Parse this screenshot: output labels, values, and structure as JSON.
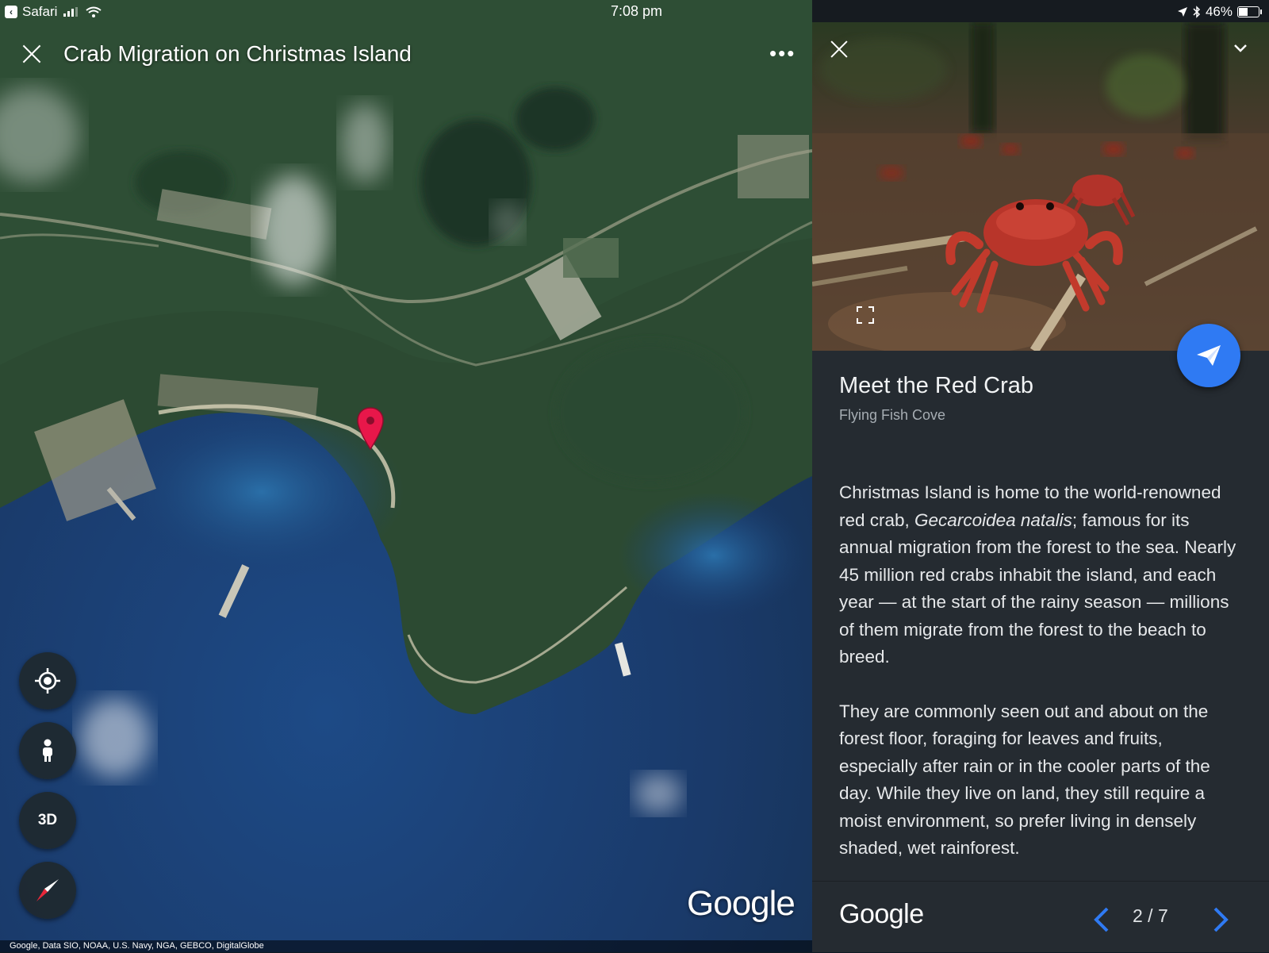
{
  "status_bar": {
    "back_app": "Safari",
    "time": "7:08 pm",
    "battery": "46%",
    "battery_level": 0.46
  },
  "map": {
    "title": "Crab Migration on Christmas Island",
    "controls": {
      "three_d_label": "3D"
    },
    "logo": "Google",
    "attribution": "Google, Data SIO, NOAA, U.S. Navy, NGA, GEBCO, DigitalGlobe"
  },
  "panel": {
    "title": "Meet the Red Crab",
    "subtitle": "Flying Fish Cove",
    "body": {
      "p1_before": "Christmas Island is home to the world-renowned red crab, ",
      "p1_italic": "Gecarcoidea natalis",
      "p1_after": "; famous for its annual migration from the forest to the sea. Nearly 45 million red crabs inhabit the island, and each year — at the start of the rainy season — millions of them migrate from the forest to the beach to breed.",
      "p2": "They are commonly seen out and about on the forest floor, foraging for leaves and fruits, especially after rain or in the cooler parts of the day. While they live on land, they still require a moist environment, so prefer living in densely shaded, wet rainforest."
    },
    "footer": {
      "logo": "Google",
      "pager": "2 / 7"
    }
  },
  "colors": {
    "accent_blue": "#2f7af3",
    "pin_red": "#e8174a",
    "panel_bg": "#252b31"
  },
  "icons": [
    "close-icon",
    "more-icon",
    "locate-icon",
    "pegman-icon",
    "compass-icon",
    "send-icon",
    "fullscreen-icon",
    "chevron-down-icon",
    "chevron-left-icon",
    "chevron-right-icon",
    "map-pin-icon"
  ]
}
